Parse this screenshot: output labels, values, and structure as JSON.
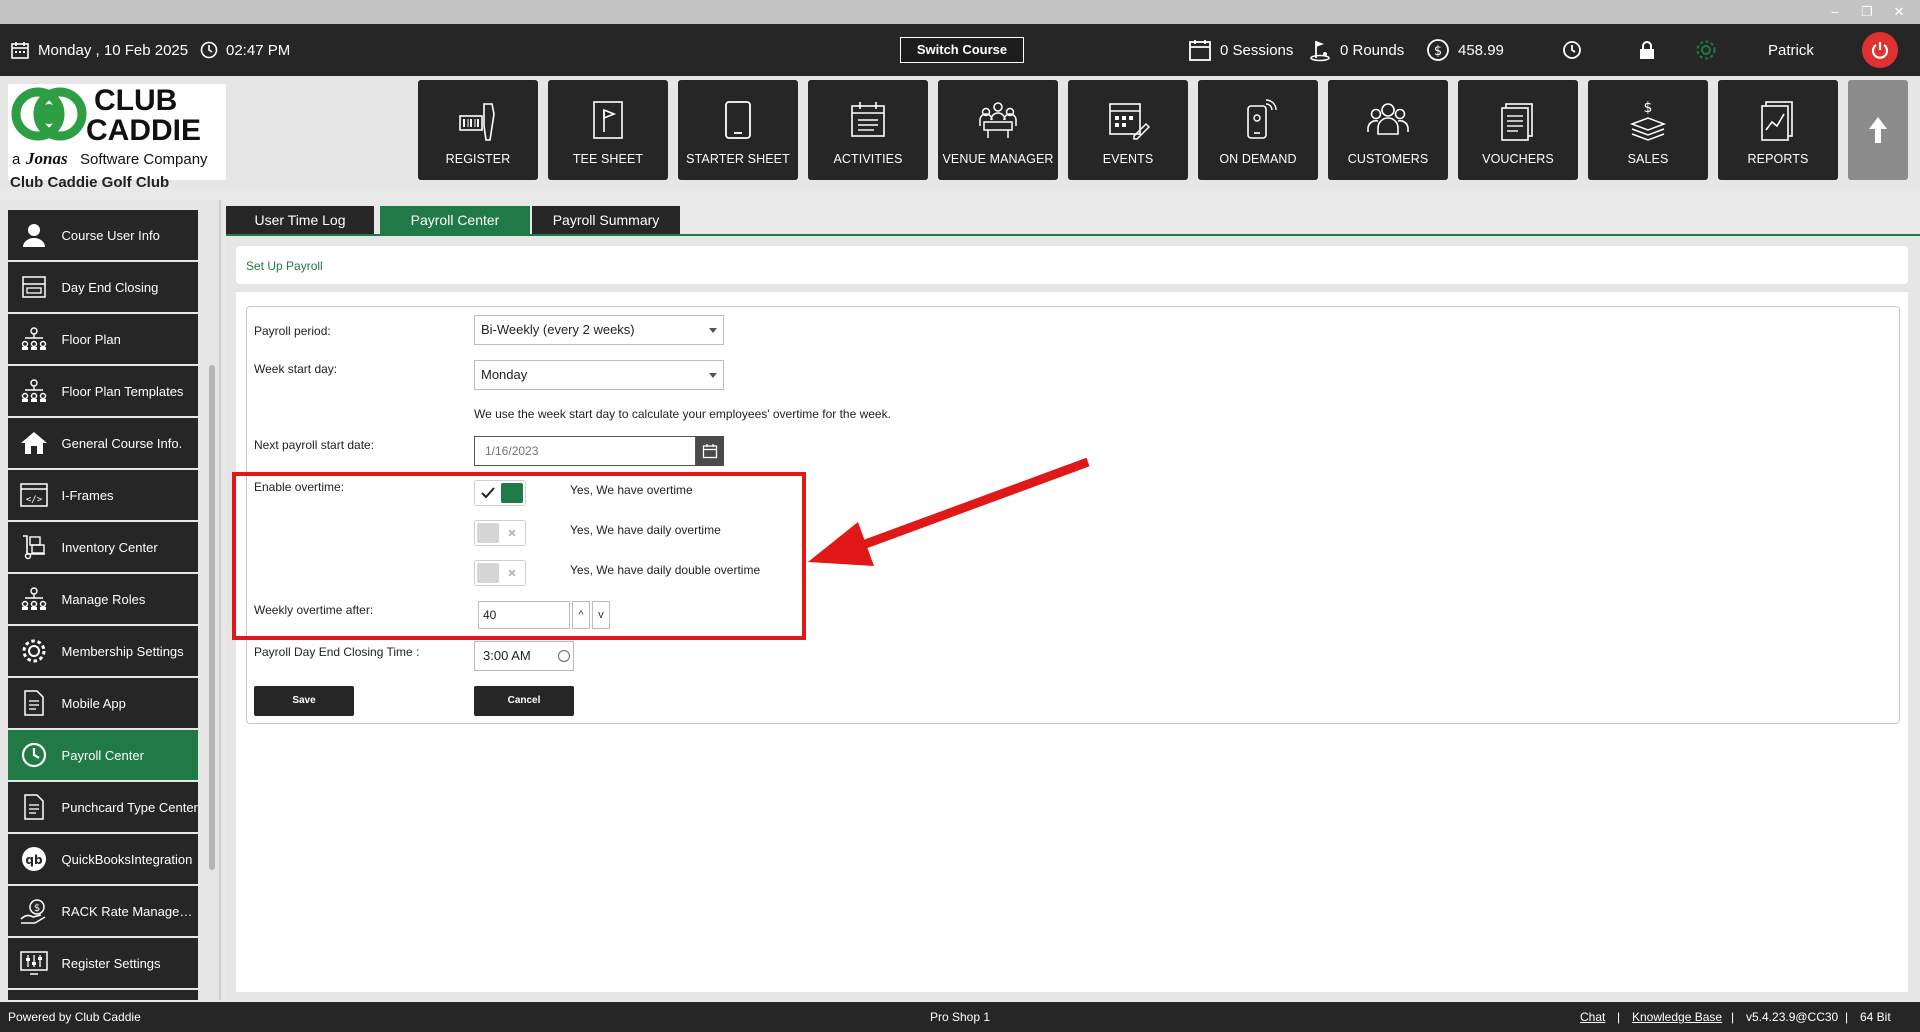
{
  "window": {
    "minimize": "–",
    "restore": "❐",
    "close": "✕"
  },
  "topbar": {
    "date": "Monday ,  10 Feb 2025",
    "time": "02:47 PM",
    "switch_course": "Switch Course",
    "sessions": "0 Sessions",
    "rounds": "0 Rounds",
    "balance": "458.99",
    "user": "Patrick"
  },
  "logo": {
    "line1": "CLUB",
    "line2": "CADDIE",
    "tagline_prefix": "a",
    "tagline_brand": "Jonas",
    "tagline_suffix": "Software Company",
    "club_name": "Club Caddie Golf Club"
  },
  "nav": [
    {
      "label": "REGISTER",
      "icon": "register-icon"
    },
    {
      "label": "TEE SHEET",
      "icon": "tee-sheet-icon"
    },
    {
      "label": "STARTER SHEET",
      "icon": "tablet-icon"
    },
    {
      "label": "ACTIVITIES",
      "icon": "activities-icon"
    },
    {
      "label": "VENUE MANAGER",
      "icon": "venue-icon"
    },
    {
      "label": "EVENTS",
      "icon": "events-icon"
    },
    {
      "label": "ON DEMAND",
      "icon": "on-demand-icon"
    },
    {
      "label": "CUSTOMERS",
      "icon": "customers-icon"
    },
    {
      "label": "VOUCHERS",
      "icon": "vouchers-icon"
    },
    {
      "label": "SALES",
      "icon": "sales-icon"
    },
    {
      "label": "REPORTS",
      "icon": "reports-icon"
    }
  ],
  "sidebar": {
    "items": [
      {
        "label": "Course User Info",
        "icon": "user-icon",
        "active": false
      },
      {
        "label": "Day End Closing",
        "icon": "register-close-icon",
        "active": false
      },
      {
        "label": "Floor Plan",
        "icon": "org-chart-icon",
        "active": false
      },
      {
        "label": "Floor Plan Templates",
        "icon": "org-chart-icon",
        "active": false
      },
      {
        "label": "General Course Info.",
        "icon": "home-icon",
        "active": false
      },
      {
        "label": "I-Frames",
        "icon": "code-icon",
        "active": false
      },
      {
        "label": "Inventory Center",
        "icon": "dolly-icon",
        "active": false
      },
      {
        "label": "Manage Roles",
        "icon": "org-chart-icon",
        "active": false
      },
      {
        "label": "Membership Settings",
        "icon": "gear-icon",
        "active": false
      },
      {
        "label": "Mobile App",
        "icon": "document-icon",
        "active": false
      },
      {
        "label": "Payroll Center",
        "icon": "clock-icon",
        "active": true
      },
      {
        "label": "Punchcard Type Center",
        "icon": "document-icon",
        "active": false
      },
      {
        "label": "QuickBooksIntegration",
        "icon": "quickbooks-icon",
        "active": false
      },
      {
        "label": "RACK Rate Manageme...",
        "icon": "rate-icon",
        "active": false
      },
      {
        "label": "Register Settings",
        "icon": "sliders-icon",
        "active": false
      }
    ]
  },
  "tabs": [
    {
      "label": "User Time Log",
      "active": false
    },
    {
      "label": "Payroll Center",
      "active": true
    },
    {
      "label": "Payroll Summary",
      "active": false
    }
  ],
  "breadcrumb": "Set Up Payroll",
  "form": {
    "payroll_period_label": "Payroll period:",
    "payroll_period_value": "Bi-Weekly (every 2 weeks)",
    "week_start_label": "Week start day:",
    "week_start_value": "Monday",
    "week_start_hint": "We use the week start day to calculate your employees' overtime for the week.",
    "next_start_label": "Next payroll start date:",
    "next_start_placeholder": "1/16/2023",
    "enable_overtime_label": "Enable overtime:",
    "overtime_toggles": [
      {
        "label": "Yes, We have overtime",
        "on": true
      },
      {
        "label": "Yes, We have daily overtime",
        "on": false
      },
      {
        "label": "Yes, We have daily double overtime",
        "on": false
      }
    ],
    "weekly_overtime_label": "Weekly overtime after:",
    "weekly_overtime_value": "40",
    "step_up": "^",
    "step_down": "v",
    "closing_time_label": "Payroll Day End Closing Time :",
    "closing_time_value": "3:00 AM",
    "save_label": "Save",
    "cancel_label": "Cancel"
  },
  "footer": {
    "powered_by": "Powered by Club Caddie",
    "station": "Pro Shop 1",
    "chat": "Chat",
    "knowledge_base": "Knowledge Base",
    "version": "v5.4.23.9@CC30",
    "bits": "64 Bit",
    "sep": "|"
  },
  "colors": {
    "accent_green": "#1f7a45",
    "dark": "#262626",
    "highlight_red": "#e01818"
  }
}
